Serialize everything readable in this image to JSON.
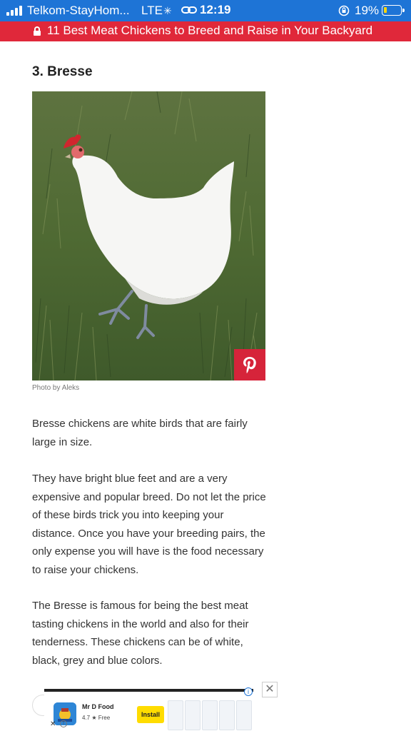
{
  "status_bar": {
    "carrier": "Telkom-StayHom...",
    "network": "LTE",
    "time": "12:19",
    "battery_percent": "19%",
    "battery_level": 0.19
  },
  "url_bar": {
    "title": "11 Best Meat Chickens to Breed and Raise in Your Backyard",
    "accent_color": "#e0283a"
  },
  "article": {
    "heading": "3. Bresse",
    "photo_caption": "Photo by Aleks",
    "paragraphs": [
      "Bresse chickens are white birds that are fairly large in size.",
      "They have bright blue feet and are a very expensive and popular breed. Do not let the price of these birds trick you into keeping your distance. Once you have your breeding pairs, the only expense you will have is the food necessary to raise your chickens.",
      "The Bresse is famous for being the best meat tasting chickens in the world and also for their tenderness. These chickens can be of white, black, grey and blue colors."
    ]
  },
  "ad": {
    "app_name": "Mr D Food",
    "rating": "4.7 ★ Free",
    "install_label": "Install",
    "close_symbol": "✕",
    "info_symbol": "i"
  },
  "icons": {
    "signal": "signal-icon",
    "lock": "lock-icon",
    "pinterest": "pinterest-icon"
  }
}
